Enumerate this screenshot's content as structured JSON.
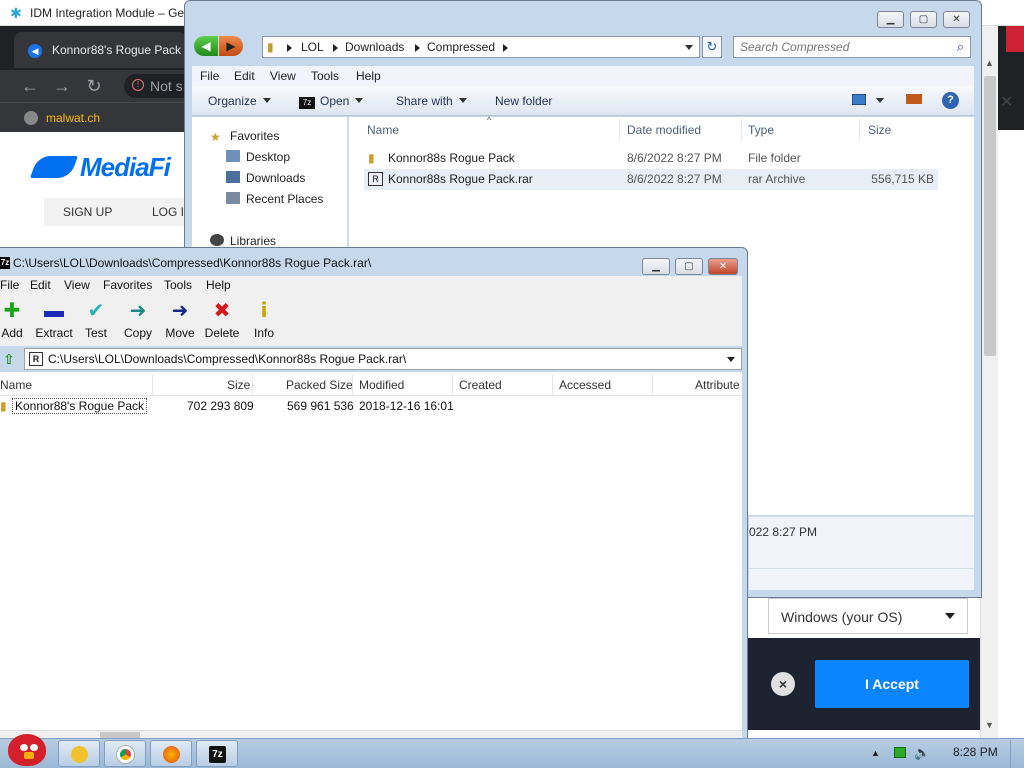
{
  "browser": {
    "idm_tab_title": "IDM Integration Module – Ge",
    "tab_title": "Konnor88's Rogue Pack",
    "omnibox_text": "Not s",
    "bookmark": "malwat.ch",
    "site_logo": "MediaFi",
    "nav_signup": "SIGN UP",
    "nav_login": "LOG I",
    "os_select": "Windows (your OS)",
    "accept_button": "I Accept",
    "close_x": "×"
  },
  "explorer": {
    "breadcrumb": [
      "LOL",
      "Downloads",
      "Compressed"
    ],
    "search_placeholder": "Search Compressed",
    "menu": [
      "File",
      "Edit",
      "View",
      "Tools",
      "Help"
    ],
    "commands": {
      "organize": "Organize",
      "open": "Open",
      "share": "Share with",
      "new_folder": "New folder"
    },
    "nav_pane": {
      "favorites": "Favorites",
      "desktop": "Desktop",
      "downloads": "Downloads",
      "recent": "Recent Places",
      "libraries": "Libraries"
    },
    "columns": {
      "name": "Name",
      "date": "Date modified",
      "type": "Type",
      "size": "Size"
    },
    "rows": [
      {
        "name": "Konnor88s Rogue Pack",
        "date": "8/6/2022 8:27 PM",
        "type": "File folder",
        "size": ""
      },
      {
        "name": "Konnor88s Rogue Pack.rar",
        "date": "8/6/2022 8:27 PM",
        "type": "rar Archive",
        "size": "556,715 KB"
      }
    ],
    "details_date": "022 8:27 PM"
  },
  "sevenzip": {
    "title": "C:\\Users\\LOL\\Downloads\\Compressed\\Konnor88s Rogue Pack.rar\\",
    "menu": [
      "File",
      "Edit",
      "View",
      "Favorites",
      "Tools",
      "Help"
    ],
    "toolbar": [
      {
        "label": "Add",
        "glyph": "+",
        "color": "#1aa51a"
      },
      {
        "label": "Extract",
        "glyph": "━",
        "color": "#1a2bb8"
      },
      {
        "label": "Test",
        "glyph": "✔",
        "color": "#27b0b8"
      },
      {
        "label": "Copy",
        "glyph": "➜",
        "color": "#1a8a8a"
      },
      {
        "label": "Move",
        "glyph": "➜",
        "color": "#1a2a8a"
      },
      {
        "label": "Delete",
        "glyph": "✖",
        "color": "#d41a1a"
      },
      {
        "label": "Info",
        "glyph": "i",
        "color": "#c8a400"
      }
    ],
    "path": "C:\\Users\\LOL\\Downloads\\Compressed\\Konnor88s Rogue Pack.rar\\",
    "columns": {
      "name": "Name",
      "size": "Size",
      "packed": "Packed Size",
      "modified": "Modified",
      "created": "Created",
      "accessed": "Accessed",
      "attributes": "Attribute"
    },
    "row": {
      "name": "Konnor88's Rogue Pack",
      "size": "702 293 809",
      "packed": "569 961 536",
      "modified": "2018-12-16 16:01"
    }
  },
  "taskbar": {
    "clock": "8:28 PM"
  }
}
